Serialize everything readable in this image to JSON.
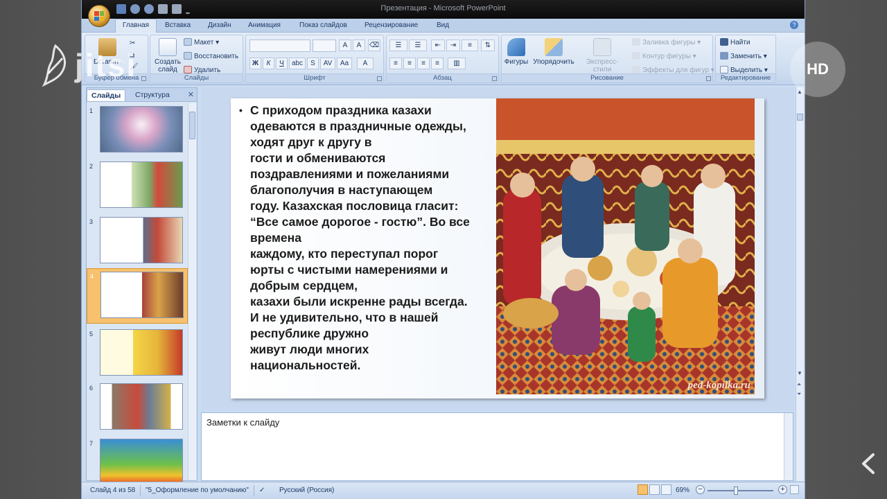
{
  "window": {
    "title": "Презентация - Microsoft PowerPoint"
  },
  "ribbon": {
    "tabs": [
      "Главная",
      "Вставка",
      "Дизайн",
      "Анимация",
      "Показ слайдов",
      "Рецензирование",
      "Вид"
    ],
    "active_tab": "Главная",
    "groups": {
      "clipboard": {
        "label": "Буфер обмена",
        "paste": "Вставить"
      },
      "slides": {
        "label": "Слайды",
        "new_slide": "Создать слайд",
        "layout": "Макет",
        "reset": "Восстановить",
        "delete": "Удалить"
      },
      "font": {
        "label": "Шрифт"
      },
      "paragraph": {
        "label": "Абзац"
      },
      "drawing": {
        "label": "Рисование",
        "shapes": "Фигуры",
        "arrange": "Упорядочить",
        "quick_styles": "Экспресс-стили",
        "shape_fill": "Заливка фигуры",
        "shape_outline": "Контур фигуры",
        "shape_effects": "Эффекты для фигур"
      },
      "editing": {
        "label": "Редактирование",
        "find": "Найти",
        "replace": "Заменить",
        "select": "Выделить"
      }
    }
  },
  "left_pane": {
    "tabs": [
      "Слайды",
      "Структура"
    ],
    "active_tab": "Слайды",
    "thumbnails": [
      {
        "number": "1"
      },
      {
        "number": "2"
      },
      {
        "number": "3"
      },
      {
        "number": "4",
        "selected": true
      },
      {
        "number": "5"
      },
      {
        "number": "6"
      },
      {
        "number": "7"
      }
    ]
  },
  "slide": {
    "bullet": "•",
    "lines": [
      "С приходом праздника казахи",
      "одеваются в праздничные одежды,",
      "ходят друг к другу в",
      "гости и обмениваются",
      "поздравлениями и пожеланиями",
      "благополучия в наступающем",
      "году. Казахская пословица гласит:",
      "“Все самое дорогое - гостю”. Во все",
      "времена",
      "каждому, кто переступал порог",
      "юрты с чистыми намерениями и",
      "добрым сердцем,",
      "казахи были искренне рады всегда.",
      "И не удивительно, что в нашей",
      "республике дружно",
      "живут люди многих",
      "национальностей."
    ],
    "image_caption": "ped-kopilka.ru"
  },
  "notes": {
    "text": "Заметки к слайду"
  },
  "status": {
    "slide_info": "Слайд 4 из 58",
    "theme": "\"5_Оформление по умолчанию\"",
    "language": "Русский (Россия)",
    "zoom": "69%"
  },
  "overlay": {
    "brand": "jitsi",
    "hd_badge": "HD"
  },
  "colors": {
    "ribbon_bg": "#cfdef1",
    "selected_thumb": "#f7c16d",
    "titlebar": "#111111"
  }
}
